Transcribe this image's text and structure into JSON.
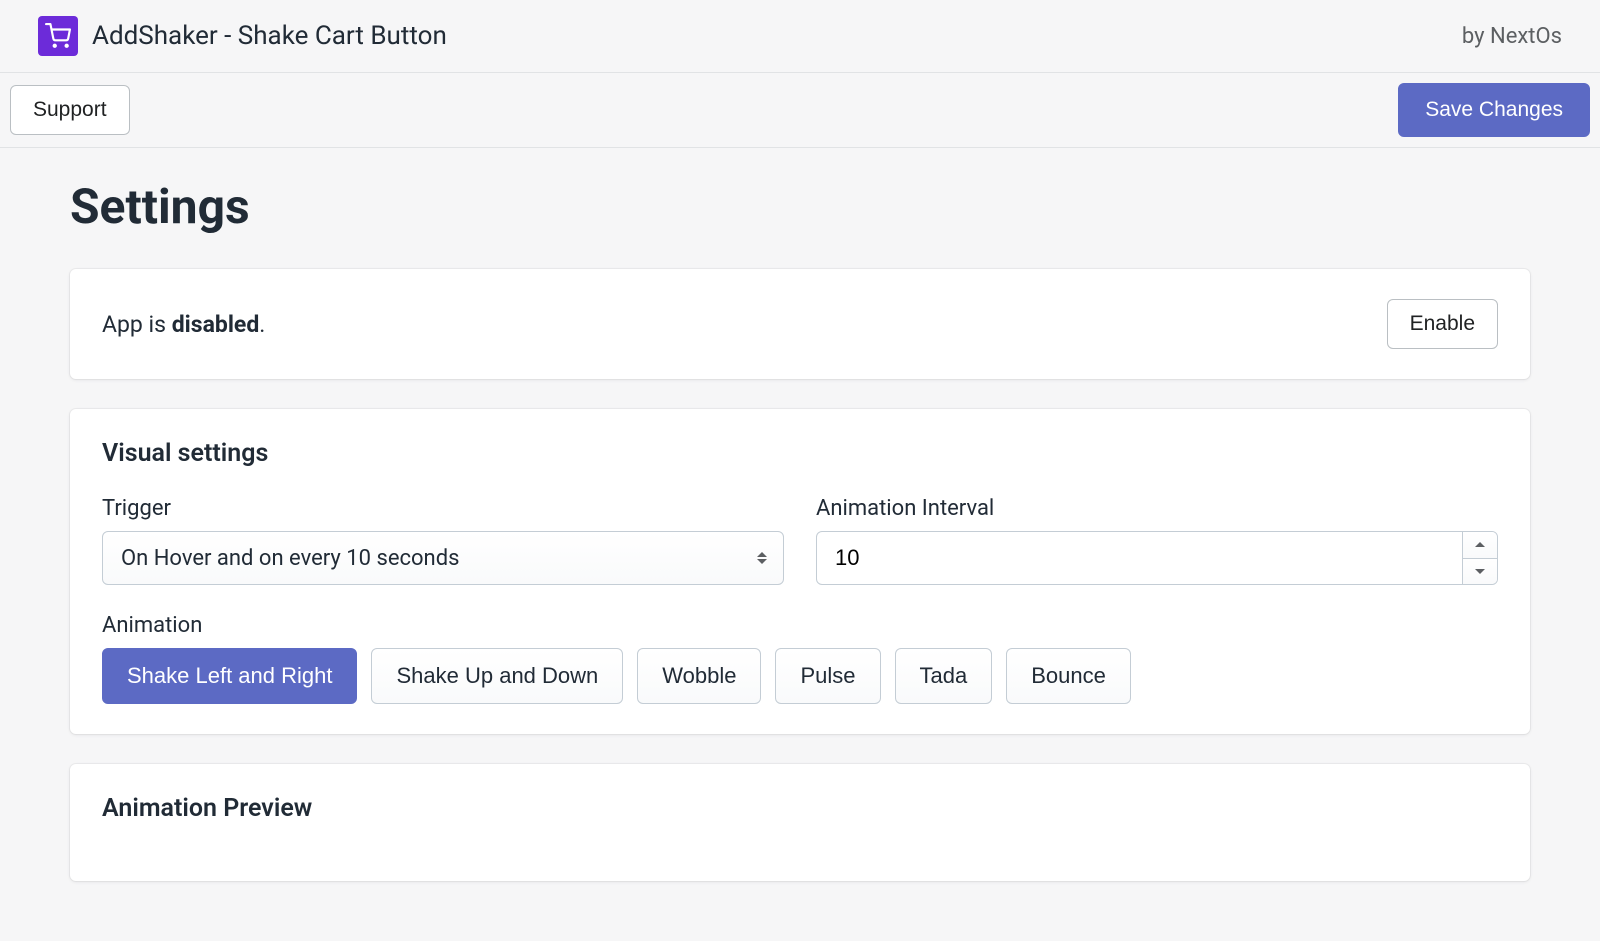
{
  "header": {
    "app_title": "AddShaker - Shake Cart Button",
    "vendor_prefix": "by ",
    "vendor_name": "NextOs"
  },
  "toolbar": {
    "support_label": "Support",
    "save_label": "Save Changes"
  },
  "page": {
    "title": "Settings"
  },
  "status": {
    "prefix": "App is ",
    "state": "disabled",
    "suffix": ".",
    "enable_label": "Enable"
  },
  "visual": {
    "heading": "Visual settings",
    "trigger_label": "Trigger",
    "trigger_value": "On Hover and on every 10 seconds",
    "interval_label": "Animation Interval",
    "interval_value": "10",
    "animation_label": "Animation",
    "animations": [
      {
        "label": "Shake Left and Right",
        "active": true
      },
      {
        "label": "Shake Up and Down",
        "active": false
      },
      {
        "label": "Wobble",
        "active": false
      },
      {
        "label": "Pulse",
        "active": false
      },
      {
        "label": "Tada",
        "active": false
      },
      {
        "label": "Bounce",
        "active": false
      }
    ]
  },
  "preview": {
    "heading": "Animation Preview"
  },
  "colors": {
    "accent": "#5c6ac4",
    "brand_icon": "#6c2bd9"
  }
}
